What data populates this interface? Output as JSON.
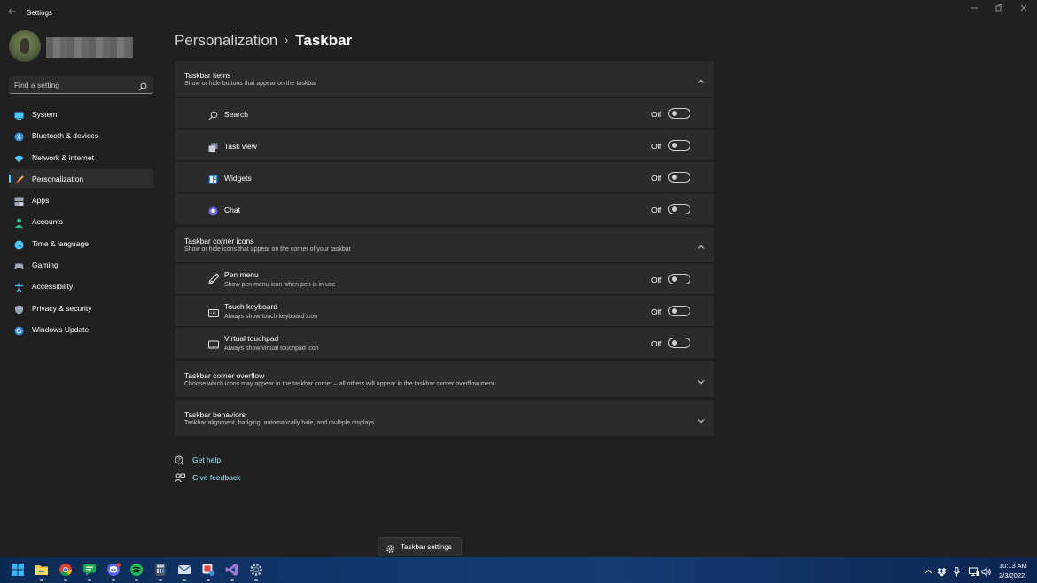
{
  "window": {
    "title": "Settings",
    "back_icon": "back-arrow-icon",
    "controls": [
      "minimize-icon",
      "restore-icon",
      "close-icon"
    ]
  },
  "search": {
    "placeholder": "Find a setting",
    "value": "",
    "icon": "search-icon"
  },
  "sidebar": {
    "items": [
      {
        "label": "System",
        "icon": "monitor-icon",
        "color": "#4cc2ff"
      },
      {
        "label": "Bluetooth & devices",
        "icon": "bluetooth-icon",
        "color": "#3a8ee6"
      },
      {
        "label": "Network & internet",
        "icon": "wifi-icon",
        "color": "#4cc2ff"
      },
      {
        "label": "Personalization",
        "icon": "brush-icon",
        "color": "#f0a050",
        "active": true
      },
      {
        "label": "Apps",
        "icon": "apps-icon",
        "color": "#9aa7b8"
      },
      {
        "label": "Accounts",
        "icon": "person-icon",
        "color": "#2fbf8a"
      },
      {
        "label": "Time & language",
        "icon": "globe-clock-icon",
        "color": "#4cc2ff"
      },
      {
        "label": "Gaming",
        "icon": "gamepad-icon",
        "color": "#9aa7b8"
      },
      {
        "label": "Accessibility",
        "icon": "accessibility-icon",
        "color": "#4cc2ff"
      },
      {
        "label": "Privacy & security",
        "icon": "shield-icon",
        "color": "#9aa7b8"
      },
      {
        "label": "Windows Update",
        "icon": "update-icon",
        "color": "#3a8ee6"
      }
    ]
  },
  "breadcrumb": {
    "parent": "Personalization",
    "separator": "›",
    "current": "Taskbar"
  },
  "sections": {
    "taskbar_items": {
      "title": "Taskbar items",
      "subtitle": "Show or hide buttons that appear on the taskbar",
      "rows": [
        {
          "label": "Search",
          "icon": "search-icon",
          "state": "Off"
        },
        {
          "label": "Task view",
          "icon": "task-view-icon",
          "state": "Off"
        },
        {
          "label": "Widgets",
          "icon": "widgets-icon",
          "state": "Off"
        },
        {
          "label": "Chat",
          "icon": "chat-icon",
          "state": "Off"
        }
      ]
    },
    "corner_icons": {
      "title": "Taskbar corner icons",
      "subtitle": "Show or hide icons that appear on the corner of your taskbar",
      "rows": [
        {
          "label": "Pen menu",
          "sub": "Show pen menu icon when pen is in use",
          "icon": "pen-icon",
          "state": "Off"
        },
        {
          "label": "Touch keyboard",
          "sub": "Always show touch keyboard icon",
          "icon": "keyboard-icon",
          "state": "Off"
        },
        {
          "label": "Virtual touchpad",
          "sub": "Always show virtual touchpad icon",
          "icon": "touchpad-icon",
          "state": "Off"
        }
      ]
    },
    "corner_overflow": {
      "title": "Taskbar corner overflow",
      "subtitle": "Choose which icons may appear in the taskbar corner – all others will appear in the taskbar corner overflow menu"
    },
    "behaviors": {
      "title": "Taskbar behaviors",
      "subtitle": "Taskbar alignment, badging, automatically hide, and multiple displays"
    }
  },
  "help": {
    "get_help": "Get help",
    "give_feedback": "Give feedback"
  },
  "tooltip": {
    "label": "Taskbar settings",
    "icon": "gear-icon"
  },
  "taskbar": {
    "apps": [
      "start-icon",
      "file-explorer-icon",
      "chrome-icon",
      "messenger-icon",
      "discord-icon",
      "spotify-icon",
      "calculator-icon",
      "mail-icon",
      "snipping-icon",
      "visual-studio-icon",
      "settings-icon"
    ],
    "tray": [
      "chevron-up-icon",
      "dropbox-icon",
      "microphone-icon",
      "network-icon",
      "volume-icon"
    ],
    "time": "10:13 AM",
    "date": "2/3/2022"
  }
}
